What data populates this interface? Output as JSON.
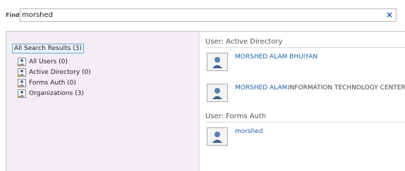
{
  "find": {
    "label": "Find",
    "value": "morshed",
    "clear_glyph": "×"
  },
  "tree": {
    "root_label": "All Search Results (3)",
    "items": [
      {
        "label": "All Users (0)",
        "icon": "users-icon"
      },
      {
        "label": "Active Directory (0)",
        "icon": "users-icon"
      },
      {
        "label": "Forms Auth (0)",
        "icon": "users-icon"
      },
      {
        "label": "Organizations (3)",
        "icon": "users-icon"
      }
    ]
  },
  "results": {
    "sections": [
      {
        "header": "User: Active Directory",
        "items": [
          {
            "name": "MORSHED ALAM BHUIYAN",
            "dept": ""
          },
          {
            "name": "MORSHED ALAM",
            "dept": "INFORMATION TECHNOLOGY CENTER"
          }
        ]
      },
      {
        "header": "User: Forms Auth",
        "items": [
          {
            "name": "morshed",
            "dept": ""
          }
        ]
      }
    ]
  },
  "colors": {
    "link": "#1f5fa6",
    "left_pane_bg": "#f3eef3",
    "selected_border": "#7aa1d3"
  }
}
